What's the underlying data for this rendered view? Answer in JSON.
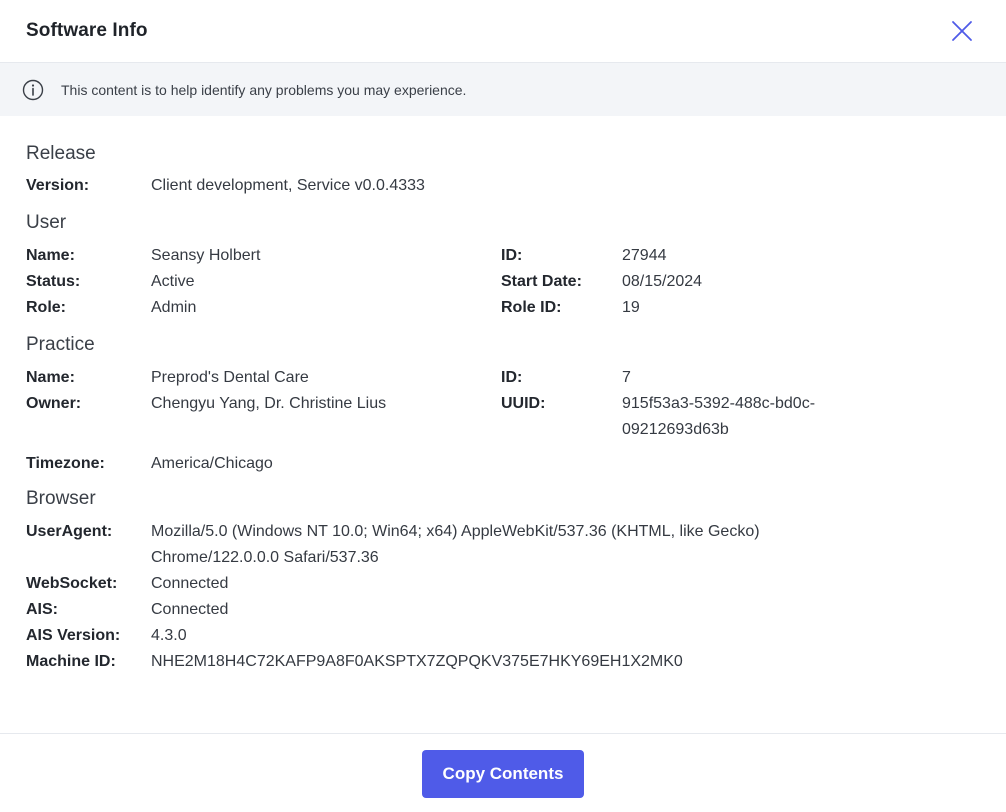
{
  "header": {
    "title": "Software Info",
    "close_icon": "close-icon",
    "accent_color": "#4f5be8"
  },
  "banner": {
    "icon": "info-icon",
    "text": "This content is to help identify any problems you may experience."
  },
  "release": {
    "title": "Release",
    "version_label": "Version:",
    "version_value": "Client development, Service v0.0.4333"
  },
  "user": {
    "title": "User",
    "name_label": "Name:",
    "name_value": "Seansy Holbert",
    "id_label": "ID:",
    "id_value": "27944",
    "status_label": "Status:",
    "status_value": "Active",
    "start_date_label": "Start Date:",
    "start_date_value": "08/15/2024",
    "role_label": "Role:",
    "role_value": "Admin",
    "role_id_label": "Role ID:",
    "role_id_value": "19"
  },
  "practice": {
    "title": "Practice",
    "name_label": "Name:",
    "name_value": "Preprod's Dental Care",
    "id_label": "ID:",
    "id_value": "7",
    "owner_label": "Owner:",
    "owner_value": "Chengyu Yang, Dr. Christine Lius",
    "uuid_label": "UUID:",
    "uuid_value_line1": "915f53a3-5392-488c-bd0c-",
    "uuid_value_line2": "09212693d63b",
    "timezone_label": "Timezone:",
    "timezone_value": "America/Chicago"
  },
  "browser": {
    "title": "Browser",
    "useragent_label": "UserAgent:",
    "useragent_line1": "Mozilla/5.0 (Windows NT 10.0; Win64; x64) AppleWebKit/537.36 (KHTML, like Gecko)",
    "useragent_line2": "Chrome/122.0.0.0 Safari/537.36",
    "websocket_label": "WebSocket:",
    "websocket_value": "Connected",
    "ais_label": "AIS:",
    "ais_value": "Connected",
    "ais_version_label": "AIS Version:",
    "ais_version_value": "4.3.0",
    "machine_id_label": "Machine ID:",
    "machine_id_value": "NHE2M18H4C72KAFP9A8F0AKSPTX7ZQPQKV375E7HKY69EH1X2MK0"
  },
  "footer": {
    "copy_label": "Copy Contents"
  }
}
